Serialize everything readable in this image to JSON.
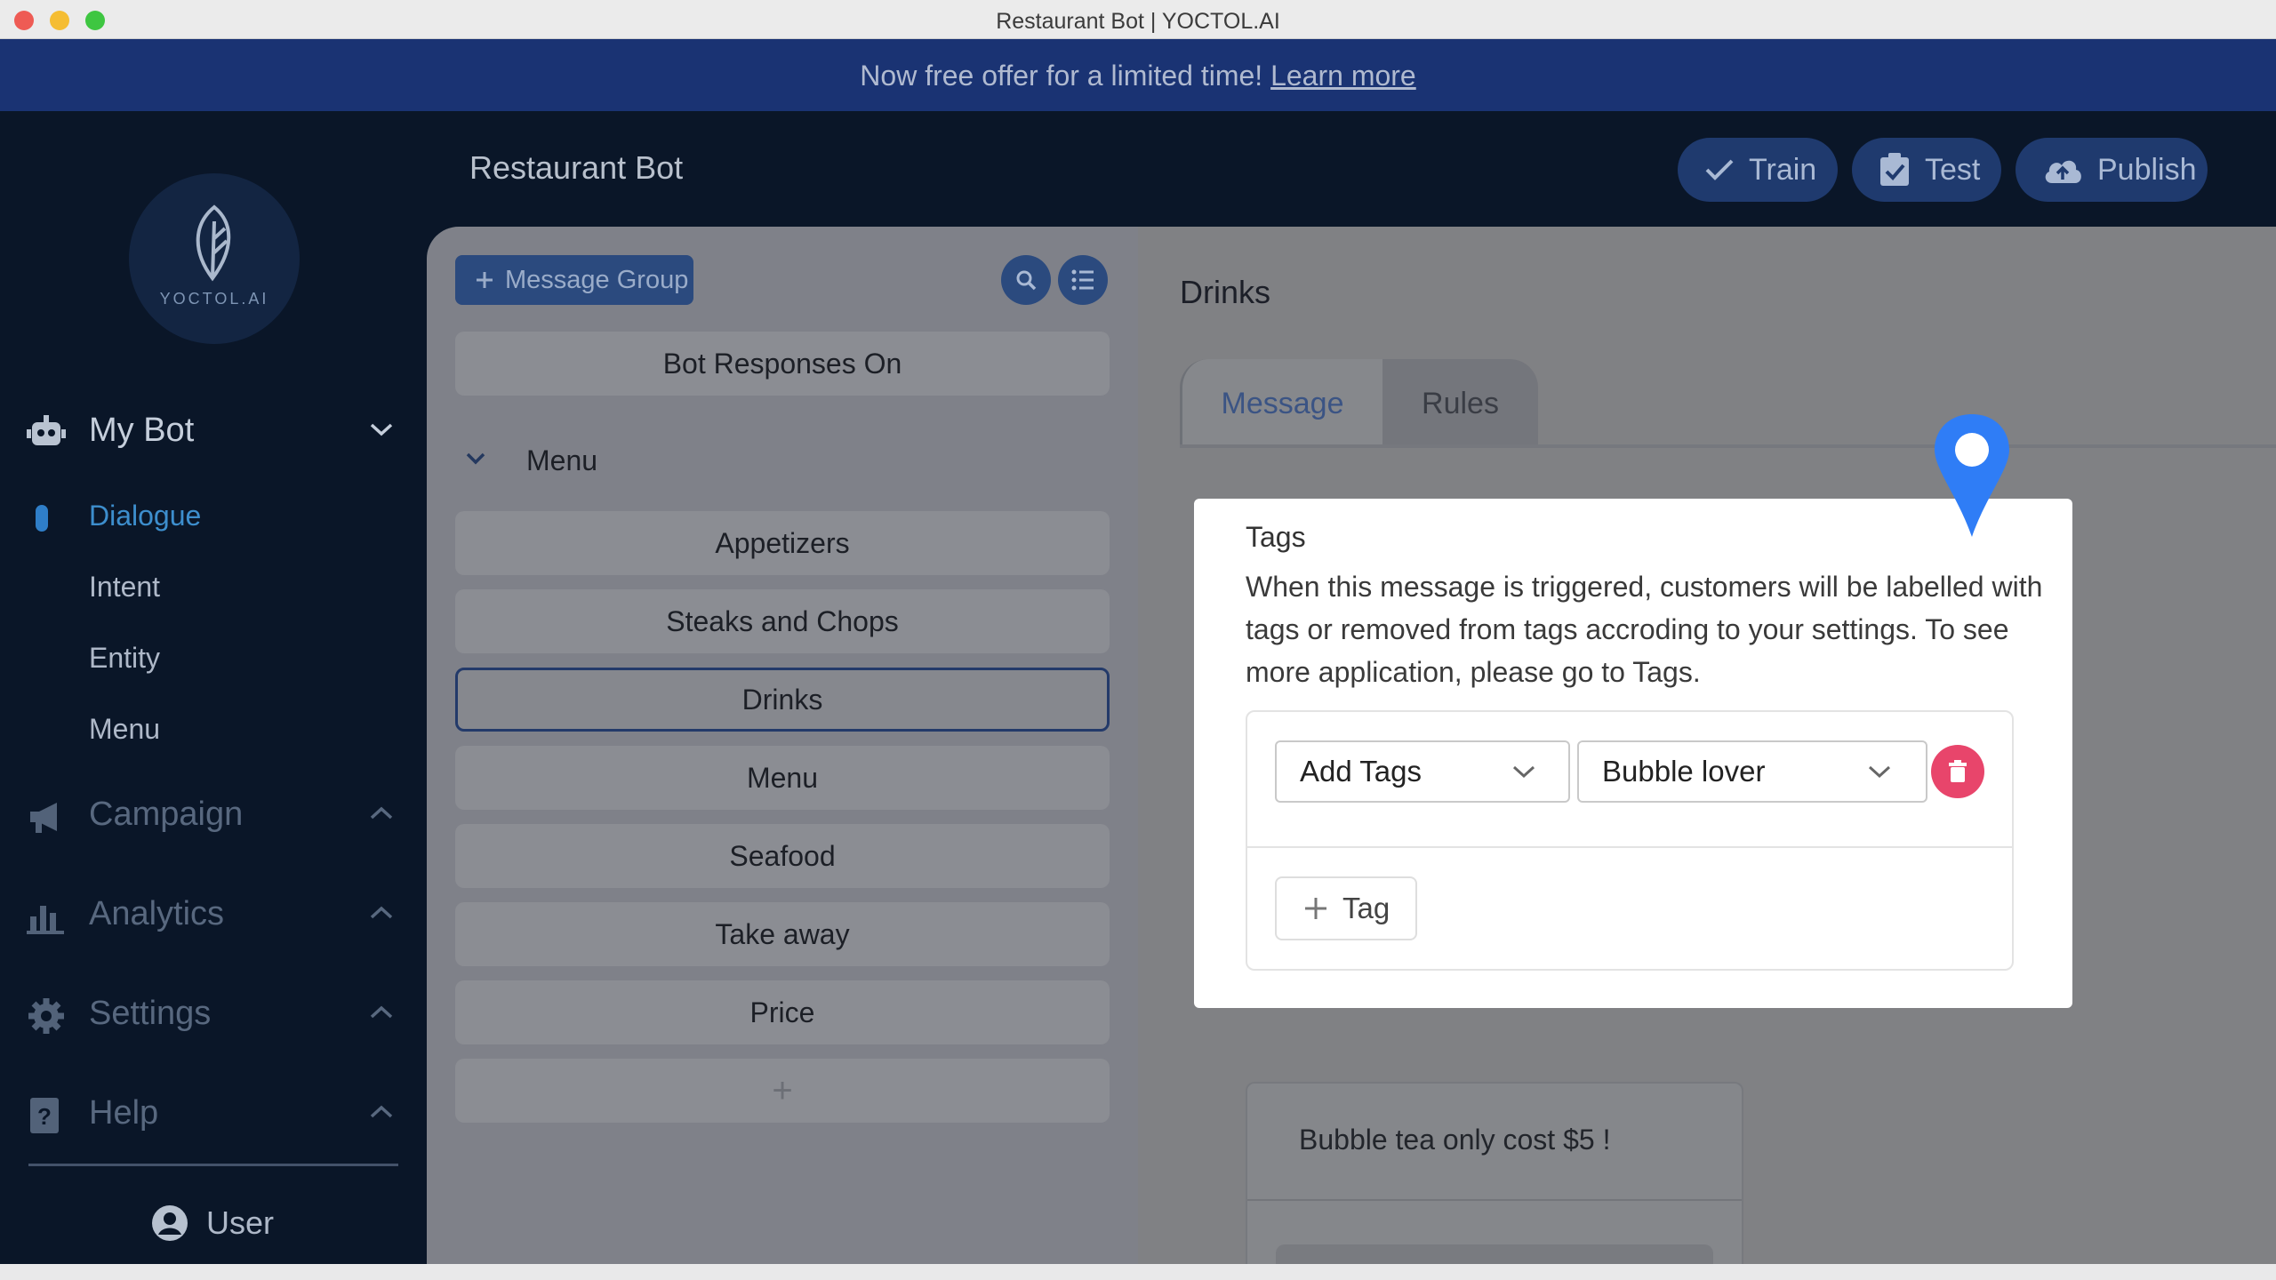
{
  "window": {
    "title": "Restaurant Bot | YOCTOL.AI"
  },
  "banner": {
    "text": "Now free offer for a limited time! ",
    "link": "Learn more"
  },
  "sidebar": {
    "logo_text": "YOCTOL.AI",
    "my_bot": "My Bot",
    "sub_items": [
      "Dialogue",
      "Intent",
      "Entity",
      "Menu"
    ],
    "sections": [
      "Campaign",
      "Analytics",
      "Settings",
      "Help"
    ],
    "user": "User"
  },
  "header": {
    "title": "Restaurant Bot",
    "train": "Train",
    "test": "Test",
    "publish": "Publish"
  },
  "groups": {
    "add_label": "Message Group",
    "bot_responses": "Bot Responses On",
    "menu_group": "Menu",
    "items": [
      "Appetizers",
      "Steaks and Chops",
      "Drinks",
      "Menu",
      "Seafood",
      "Take away",
      "Price"
    ],
    "selected": "Drinks",
    "add_item": "+"
  },
  "detail": {
    "heading": "Drinks",
    "tabs": [
      "Message",
      "Rules"
    ],
    "tags_title": "Tags",
    "tags_desc": "When this message is triggered, customers will be labelled with tags or removed from tags accroding to your settings. To see more application, please go to Tags.",
    "action_select": "Add Tags",
    "tag_select": "Bubble lover",
    "add_tag": "Tag",
    "message_text": "Bubble tea only cost $5 !"
  },
  "colors": {
    "banner": "#1a3373",
    "sidebar": "#0a1628",
    "accent": "#2b4a7e",
    "delete": "#e8456b",
    "pin": "#2f7df6"
  }
}
